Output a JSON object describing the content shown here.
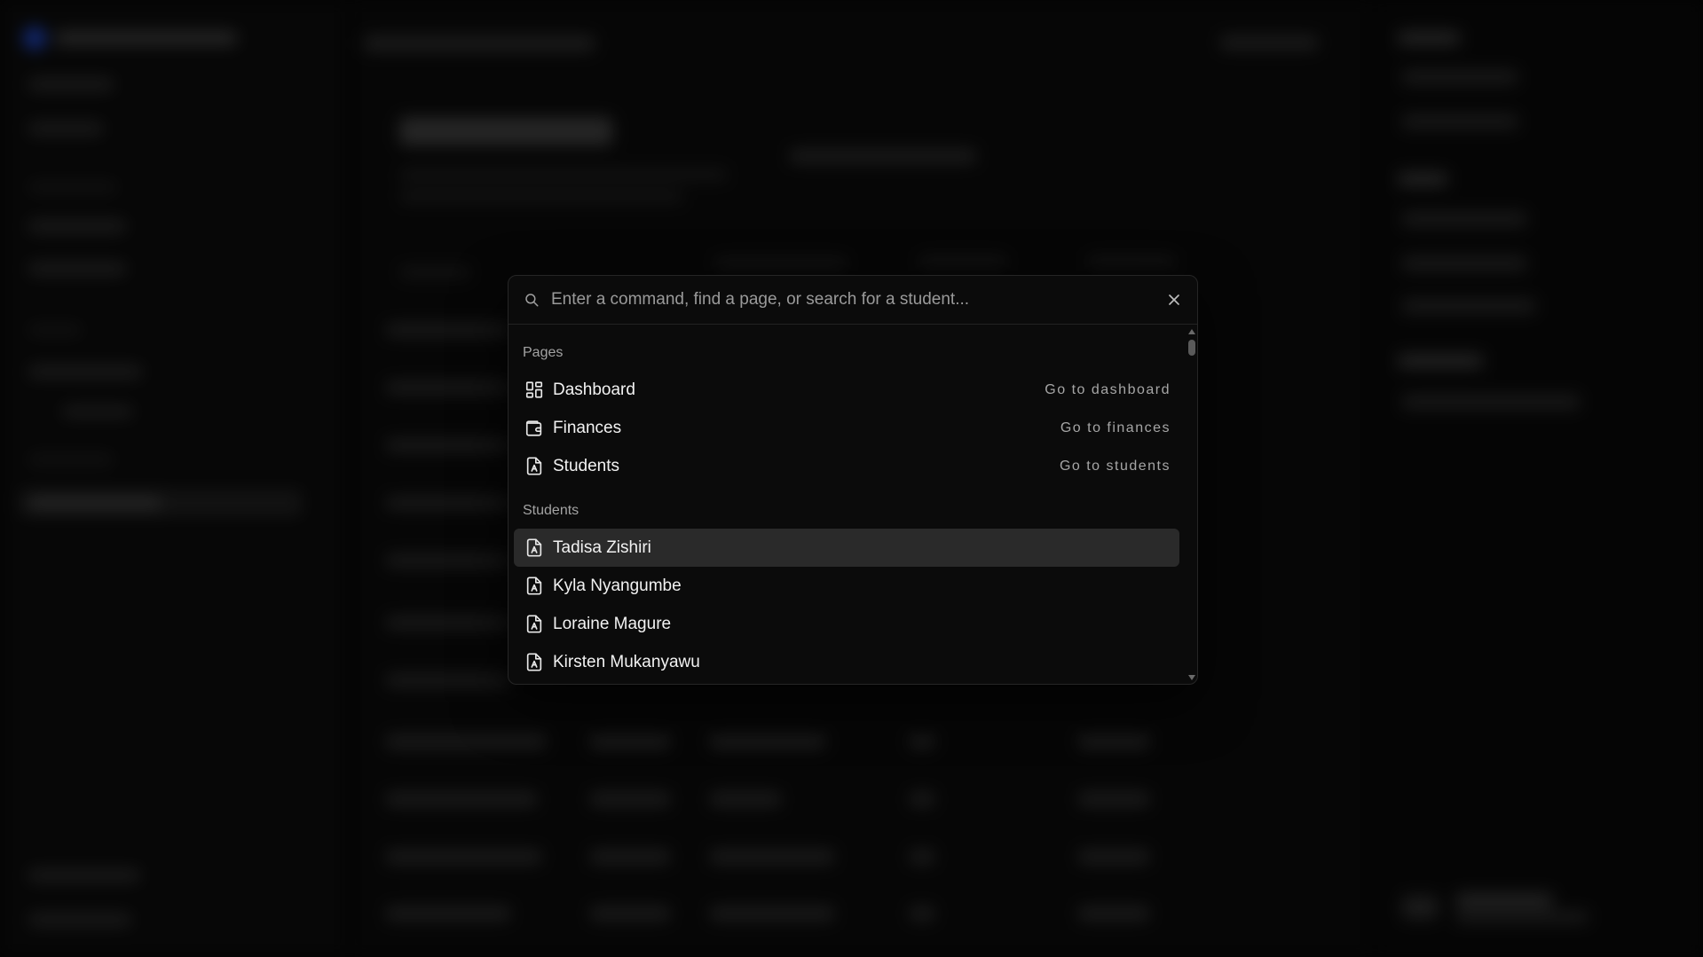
{
  "palette": {
    "search_placeholder": "Enter a command, find a page, or search for a student...",
    "search_value": "",
    "groups": {
      "pages": {
        "heading": "Pages",
        "items": [
          {
            "label": "Dashboard",
            "shortcut": "Go to dashboard",
            "icon": "dashboard-grid-icon"
          },
          {
            "label": "Finances",
            "shortcut": "Go to finances",
            "icon": "wallet-icon"
          },
          {
            "label": "Students",
            "shortcut": "Go to students",
            "icon": "student-file-icon"
          }
        ]
      },
      "students": {
        "heading": "Students",
        "items": [
          {
            "label": "Tadisa Zishiri",
            "icon": "student-file-icon",
            "selected": true
          },
          {
            "label": "Kyla Nyangumbe",
            "icon": "student-file-icon"
          },
          {
            "label": "Loraine Magure",
            "icon": "student-file-icon"
          },
          {
            "label": "Kirsten Mukanyawu",
            "icon": "student-file-icon"
          }
        ]
      }
    }
  },
  "colors": {
    "background": "#060606",
    "palette_bg": "#0b0b0b",
    "selected_row": "#2a2a2a",
    "text_primary": "#f2f2f2",
    "text_muted": "#a3a3a3",
    "brand_blue": "#1c3fb0"
  }
}
